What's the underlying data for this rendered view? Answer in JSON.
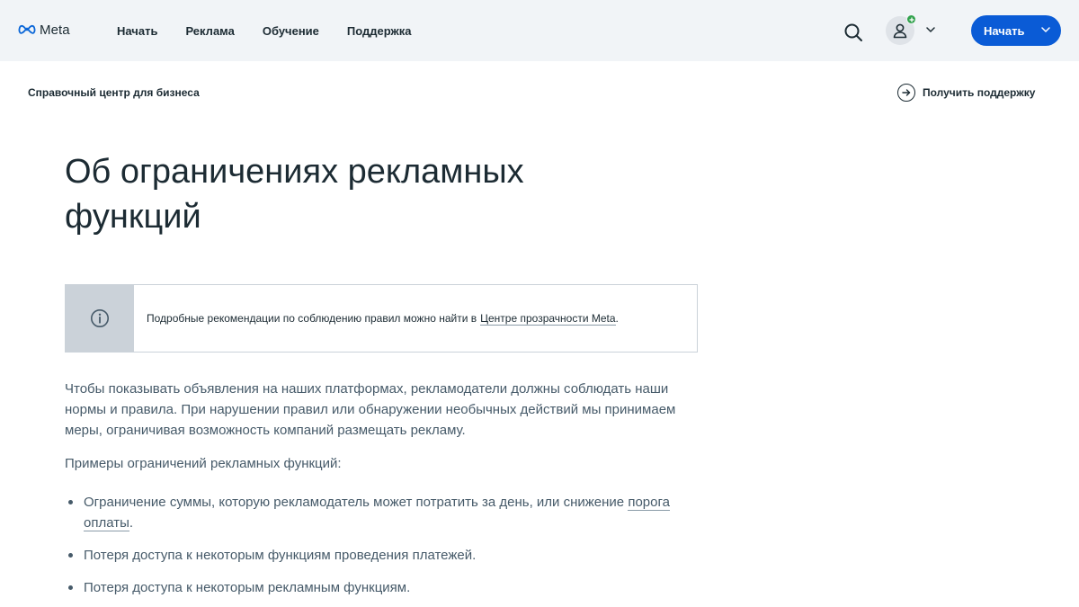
{
  "header": {
    "logo_text": "Meta",
    "nav": [
      "Начать",
      "Реклама",
      "Обучение",
      "Поддержка"
    ],
    "start_button_label": "Начать",
    "icons": [
      "search-icon",
      "user-icon",
      "chevron-down-icon"
    ]
  },
  "subheader": {
    "title": "Справочный центр для бизнеса",
    "support_label": "Получить поддержку"
  },
  "article": {
    "title": "Об ограничениях рекламных функций",
    "notice_text": "Подробные рекомендации по соблюдению правил можно найти в",
    "notice_link": "Центре прозрачности Meta",
    "notice_suffix": ".",
    "intro": "Чтобы показывать объявления на наших платформах, рекламодатели должны соблюдать наши нормы и правила. При нарушении правил или обнаружении необычных действий мы принимаем меры, ограничивая возможность компаний размещать рекламу.",
    "examples_label": "Примеры ограничений рекламных функций:",
    "items": [
      {
        "text": "Ограничение суммы, которую рекламодатель может потратить за день, или снижение ",
        "link": "порога оплаты",
        "suffix": "."
      },
      {
        "text": "Потеря доступа к некоторым функциям проведения платежей."
      },
      {
        "text": "Потеря доступа к некоторым рекламным функциям."
      }
    ]
  },
  "colors": {
    "nav_background": "#f1f4f7",
    "primary_button": "#0a5bd6",
    "status_dot": "#31a24c",
    "notice_side": "#cbd2d9",
    "body_text": "#465a69",
    "heading_text": "#1c2b33"
  }
}
